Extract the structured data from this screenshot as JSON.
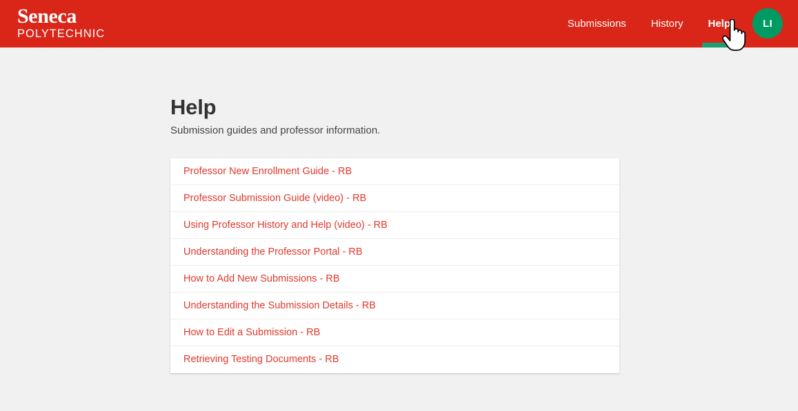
{
  "header": {
    "brand": {
      "name": "Seneca",
      "subtitle": "POLYTECHNIC"
    },
    "nav": [
      {
        "label": "Submissions",
        "active": false
      },
      {
        "label": "History",
        "active": false
      },
      {
        "label": "Help",
        "active": true
      }
    ],
    "avatar": {
      "initials": "LI"
    },
    "colors": {
      "header_background": "#da2619",
      "active_underline": "#1e9e72",
      "avatar_background": "#009b63"
    }
  },
  "main": {
    "title": "Help",
    "subtitle": "Submission guides and professor information.",
    "links": [
      {
        "label": "Professor New Enrollment Guide - RB"
      },
      {
        "label": "Professor Submission Guide (video) - RB"
      },
      {
        "label": "Using Professor History and Help (video) - RB"
      },
      {
        "label": "Understanding the Professor Portal - RB"
      },
      {
        "label": "How to Add New Submissions - RB"
      },
      {
        "label": "Understanding the Submission Details - RB"
      },
      {
        "label": "How to Edit a Submission - RB"
      },
      {
        "label": "Retrieving Testing Documents - RB"
      }
    ],
    "link_color": "#e0382c"
  },
  "cursor": {
    "icon": "pointing-hand-cursor"
  }
}
